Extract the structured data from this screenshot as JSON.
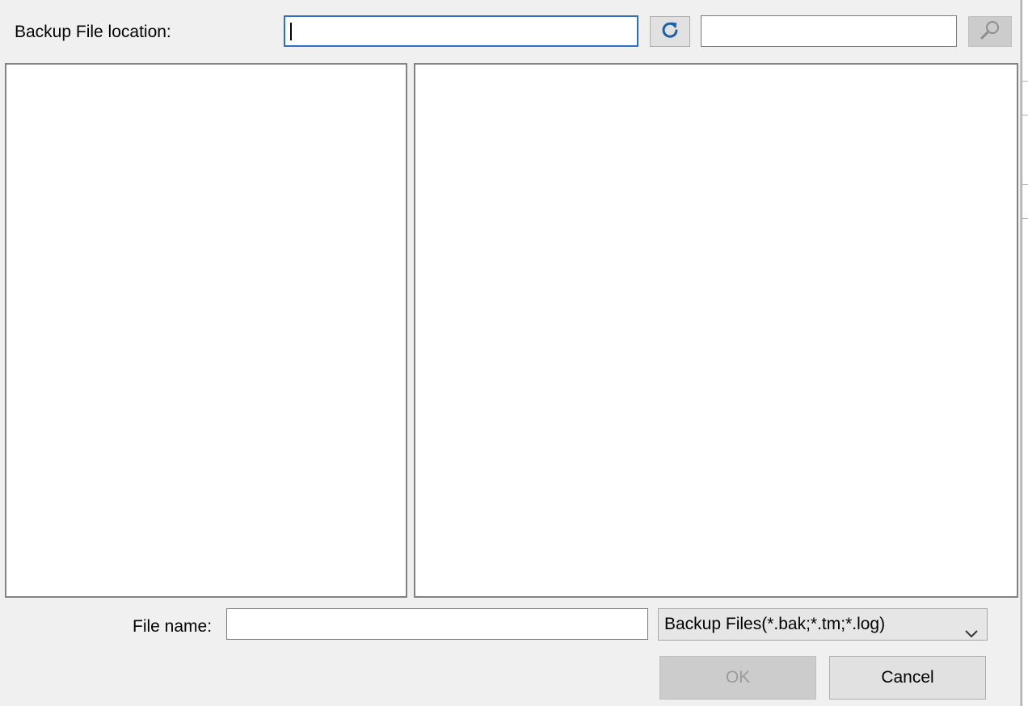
{
  "location": {
    "label": "Backup File location:",
    "path_value": "",
    "search_value": ""
  },
  "toolbar": {
    "refresh_icon": "refresh-icon",
    "search_icon": "search-icon"
  },
  "file": {
    "name_label": "File name:",
    "name_value": "",
    "filter_selected": "Backup Files(*.bak;*.tm;*.log)"
  },
  "buttons": {
    "ok": "OK",
    "cancel": "Cancel"
  },
  "colors": {
    "dialog_bg": "#f0f0f0",
    "focus_border": "#2f6fc2",
    "refresh_icon": "#1f5fa8"
  }
}
